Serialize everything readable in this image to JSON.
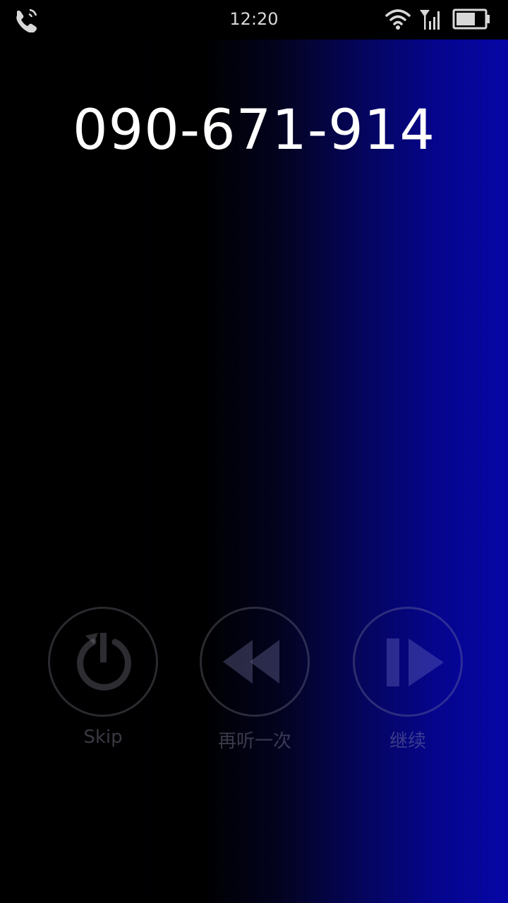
{
  "status_bar": {
    "time": "12:20",
    "icons": [
      "phone-call-icon",
      "wifi-icon",
      "signal-icon",
      "battery-icon"
    ]
  },
  "phone_number": "090-671-914",
  "controls": [
    {
      "label": "Skip",
      "icon": "power-icon"
    },
    {
      "label": "再听一次",
      "icon": "rewind-icon"
    },
    {
      "label": "继续",
      "icon": "play-pause-icon"
    }
  ],
  "colors": {
    "background_start": "#000000",
    "background_end": "#0606a8",
    "number_text": "#ffffff"
  }
}
